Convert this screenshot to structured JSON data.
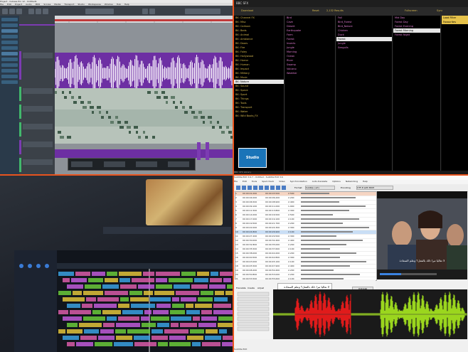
{
  "q1": {
    "title": "Project - Cubase Pro 12 - Untitled1",
    "menu": [
      "File",
      "Edit",
      "Project",
      "Audio",
      "MIDI",
      "Scores",
      "Media",
      "Transport",
      "Studio",
      "Workspaces",
      "Window",
      "Hub",
      "Help"
    ]
  },
  "q2": {
    "title": "BBC SFX",
    "nav": [
      "Download",
      "Reset",
      "2,132 Results",
      "Fullscreen",
      "Sync"
    ],
    "categories": [
      "BK: Channel FX",
      "BK: Misc",
      "BK: Cartoon",
      "BK: Beds",
      "BK: Animal",
      "BK: Ambiance",
      "BK: Doors",
      "BK: Fire",
      "BK: Foley",
      "BK: Hollywood",
      "BK: Horror",
      "BK: Human",
      "BK: Impact",
      "BK: Military",
      "BK: Music",
      "BK: Nature",
      "BK: Sound",
      "BK: Space",
      "BK: Sport",
      "BK: Things",
      "BK: Tools",
      "BK: Transport",
      "BK: Water",
      "BK: Wild Boots_FX"
    ],
    "selected_category": "BK: Nature",
    "col2": [
      "Bird",
      "Cave",
      "Desert",
      "Earthquake",
      "Farm",
      "Forest",
      "Insects",
      "Jungle",
      "Morning",
      "Ocean",
      "River",
      "Swamp",
      "Volcano",
      "Weather"
    ],
    "col3": [
      "Fall",
      "Bird_Forest",
      "Bird_Nature",
      "Chicken",
      "Duck",
      "Forest",
      "Jungle",
      "Seagulls"
    ],
    "col4": [
      "Mid Day",
      "Forest Day",
      "Forest Evening",
      "Forest Morning",
      "Forest Night"
    ],
    "selected_col4": "Forest Morning",
    "col5": [
      "Load Filter Favourites"
    ],
    "logo": "Studio",
    "status": "BBC SFX Library"
  },
  "q4": {
    "title": "Subtitle Edit 3.6.7 - Untitled - Subtitle Edit 3.6",
    "menu": [
      "File",
      "Edit",
      "Tools",
      "Spell check",
      "Video",
      "Synchronization",
      "Auto-translate",
      "Options",
      "Networking",
      "Help"
    ],
    "format_label": "Format",
    "format_value": "SubRip (.srt)",
    "encoding_label": "Encoding",
    "encoding_value": "UTF-8 with BOM",
    "rows": [
      {
        "n": "1",
        "start": "00:00:01.000",
        "end": "00:00:03.500",
        "dur": "2.500"
      },
      {
        "n": "2",
        "start": "00:00:04.000",
        "end": "00:00:06.200",
        "dur": "2.200"
      },
      {
        "n": "3",
        "start": "00:00:06.500",
        "end": "00:00:08.900",
        "dur": "2.400"
      },
      {
        "n": "4",
        "start": "00:00:09.100",
        "end": "00:00:11.000",
        "dur": "1.900"
      },
      {
        "n": "5",
        "start": "00:00:11.500",
        "end": "00:00:13.800",
        "dur": "2.300"
      },
      {
        "n": "6",
        "start": "00:00:14.000",
        "end": "00:00:16.500",
        "dur": "2.500"
      },
      {
        "n": "7",
        "start": "00:00:17.000",
        "end": "00:00:19.100",
        "dur": "2.100"
      },
      {
        "n": "8",
        "start": "00:00:19.500",
        "end": "00:00:21.700",
        "dur": "2.200"
      },
      {
        "n": "9",
        "start": "00:00:22.000",
        "end": "00:00:24.300",
        "dur": "2.300"
      },
      {
        "n": "10",
        "start": "00:00:24.800",
        "end": "00:00:26.900",
        "dur": "2.100"
      },
      {
        "n": "11",
        "start": "00:00:27.200",
        "end": "00:00:29.500",
        "dur": "2.300"
      },
      {
        "n": "12",
        "start": "00:00:30.000",
        "end": "00:00:32.400",
        "dur": "2.400"
      },
      {
        "n": "13",
        "start": "00:00:32.800",
        "end": "00:00:35.000",
        "dur": "2.200"
      },
      {
        "n": "14",
        "start": "00:00:35.500",
        "end": "00:00:37.600",
        "dur": "2.100"
      },
      {
        "n": "15",
        "start": "00:00:38.000",
        "end": "00:00:40.200",
        "dur": "2.200"
      },
      {
        "n": "16",
        "start": "00:00:40.500",
        "end": "00:00:42.800",
        "dur": "2.300"
      },
      {
        "n": "17",
        "start": "00:00:43.000",
        "end": "00:00:45.100",
        "dur": "2.100"
      },
      {
        "n": "18",
        "start": "00:00:45.500",
        "end": "00:00:47.900",
        "dur": "2.400"
      },
      {
        "n": "19",
        "start": "00:00:48.200",
        "end": "00:00:50.400",
        "dur": "2.200"
      },
      {
        "n": "20",
        "start": "00:00:50.800",
        "end": "00:00:53.000",
        "dur": "2.200"
      },
      {
        "n": "21",
        "start": "00:00:53.500",
        "end": "00:00:55.600",
        "dur": "2.100"
      },
      {
        "n": "22",
        "start": "00:00:56.000",
        "end": "00:00:58.300",
        "dur": "2.300"
      }
    ],
    "subtitle_text": "لا تعاليا تبرا ذلك بالفعل؟ وعلم السعادة",
    "video_subtitle": "لا تعاليا تبرا ذلك بالفعل؟ وعلم السعادة",
    "buttons": [
      "Prev",
      "Next",
      "Unbreak",
      "Auto br"
    ],
    "waveform_tabs": [
      "Translate",
      "Create",
      "Adjust"
    ],
    "status": "Subtitle Edit"
  },
  "colors": {
    "divider": "#e8541e",
    "wave_red": "#e01b1b",
    "wave_green": "#9bd61e",
    "sfx_gold": "#d6b84e",
    "sfx_pink": "#e07bd1"
  }
}
